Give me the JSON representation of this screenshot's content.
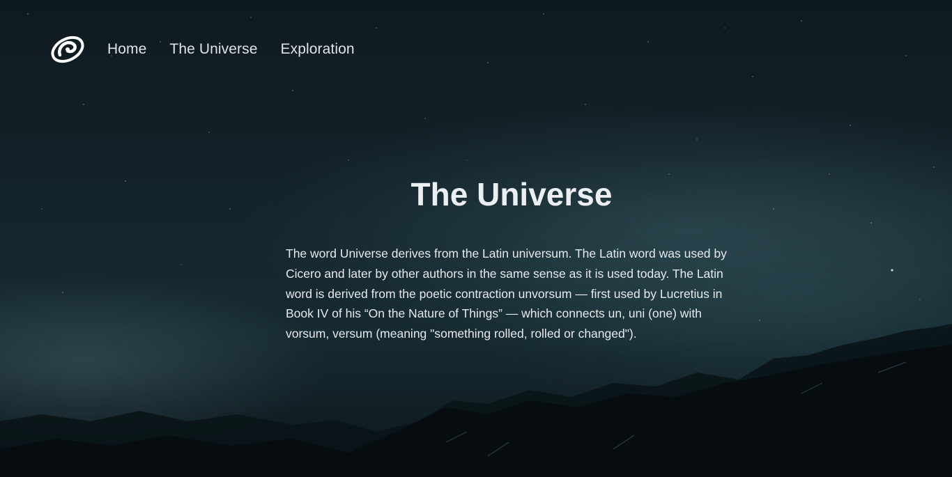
{
  "nav": {
    "logo_icon": "spiral-galaxy-icon",
    "items": [
      {
        "label": "Home"
      },
      {
        "label": "The Universe"
      },
      {
        "label": "Exploration"
      }
    ]
  },
  "hero": {
    "title": "The Universe",
    "body": "The word Universe derives from the Latin universum. The Latin word was used by Cicero and later by other authors in the same sense as it is used today. The Latin word is derived from the poetic contraction unvorsum — first used by Lucretius in Book IV of his “On the Nature of Things” — which connects un, uni (one) with vorsum, versum (meaning \"something rolled, rolled or changed\")."
  },
  "colors": {
    "background": "#13232a",
    "text": "#e6eaec",
    "mountains": "#070d10"
  }
}
